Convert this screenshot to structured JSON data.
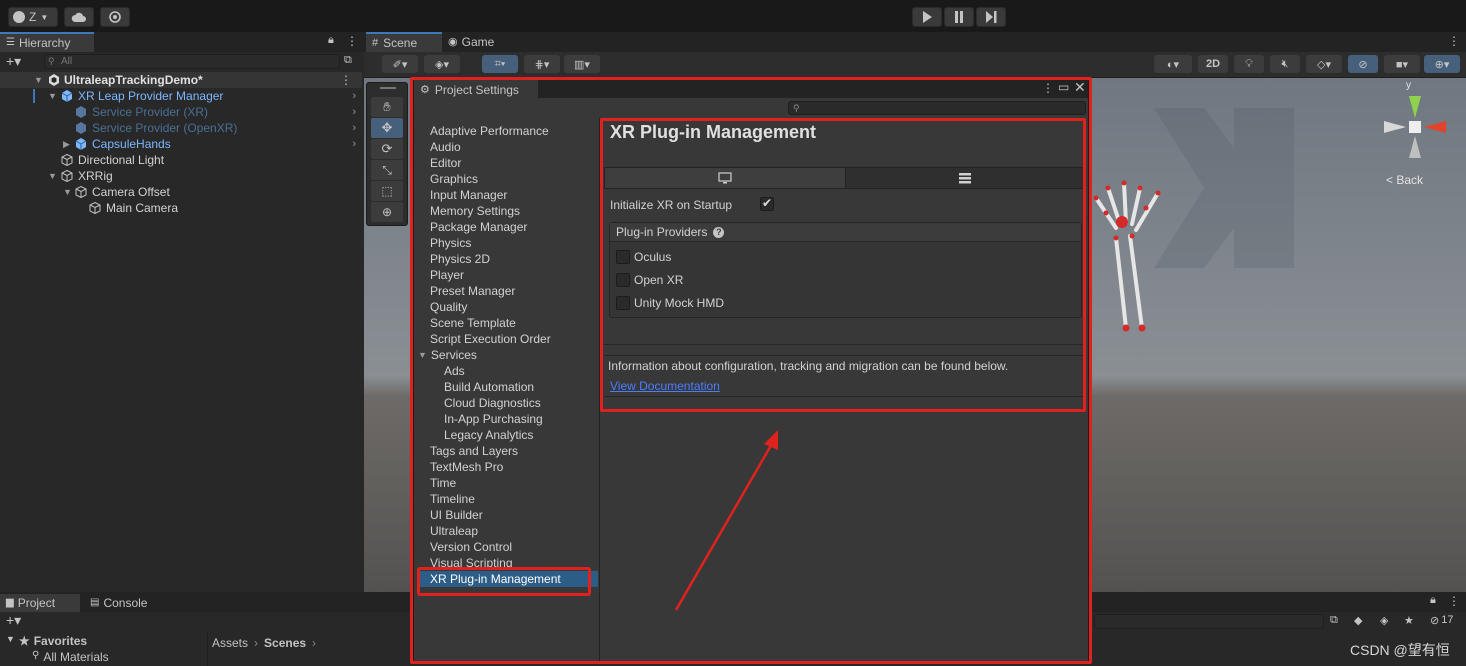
{
  "toolbar": {
    "account_label": "Z",
    "cloud_icon": "cloud-icon",
    "collab_icon": "gear-icon",
    "play_icon": "play-icon",
    "pause_icon": "pause-icon",
    "step_icon": "step-icon"
  },
  "hierarchy": {
    "tab_label": "Hierarchy",
    "search_placeholder": "All",
    "scene_name": "UltraleapTrackingDemo*",
    "items": [
      {
        "label": "XR Leap Provider Manager"
      },
      {
        "label": "Service Provider (XR)"
      },
      {
        "label": "Service Provider (OpenXR)"
      },
      {
        "label": "CapsuleHands"
      },
      {
        "label": "Directional Light"
      },
      {
        "label": "XRRig"
      },
      {
        "label": "Camera Offset"
      },
      {
        "label": "Main Camera"
      }
    ]
  },
  "scene_tabs": {
    "scene": "Scene",
    "game": "Game",
    "mode_2d": "2D",
    "back_label": "< Back",
    "gizmo_y": "y",
    "hidden_count": "17"
  },
  "project_settings": {
    "title": "Project Settings",
    "search_placeholder": "",
    "categories": [
      "Adaptive Performance",
      "Audio",
      "Editor",
      "Graphics",
      "Input Manager",
      "Memory Settings",
      "Package Manager",
      "Physics",
      "Physics 2D",
      "Player",
      "Preset Manager",
      "Quality",
      "Scene Template",
      "Script Execution Order"
    ],
    "services_label": "Services",
    "services": [
      "Ads",
      "Build Automation",
      "Cloud Diagnostics",
      "In-App Purchasing",
      "Legacy Analytics"
    ],
    "categories_after": [
      "Tags and Layers",
      "TextMesh Pro",
      "Time",
      "Timeline",
      "UI Builder",
      "Ultraleap",
      "Version Control",
      "Visual Scripting"
    ],
    "selected": "XR Plug-in Management"
  },
  "xr": {
    "heading": "XR Plug-in Management",
    "tab_desktop_icon": "monitor-icon",
    "tab_other_icon": "list-icon",
    "init_label": "Initialize XR on Startup",
    "init_checked": true,
    "providers_label": "Plug-in Providers",
    "providers": [
      {
        "label": "Oculus",
        "checked": false
      },
      {
        "label": "Open XR",
        "checked": false
      },
      {
        "label": "Unity Mock HMD",
        "checked": false
      }
    ],
    "info_text": "Information about configuration, tracking and migration can be found below.",
    "doc_link": "View Documentation"
  },
  "bottom": {
    "project_tab": "Project",
    "console_tab": "Console",
    "favorites_label": "Favorites",
    "all_materials": "All Materials",
    "breadcrumb_assets": "Assets",
    "breadcrumb_scenes": "Scenes"
  },
  "watermark": "CSDN @望有恒",
  "colors": {
    "accent_red": "#e0221e",
    "selection_blue": "#2c5d87",
    "link_blue": "#4c7eff",
    "prefab_blue": "#7cb7ff"
  }
}
